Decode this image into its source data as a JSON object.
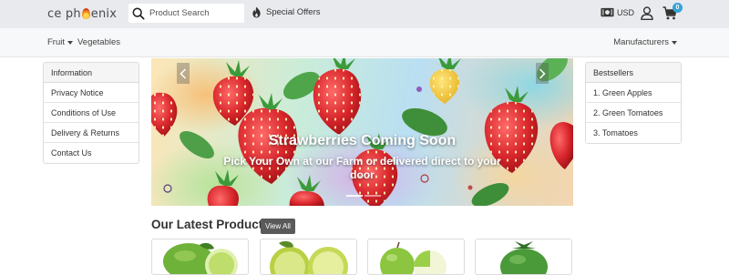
{
  "header": {
    "logo_text": "ce phoenix",
    "search": {
      "placeholder": "Product Search"
    },
    "special_offers_label": "Special Offers",
    "currency_label": "USD",
    "cart_count": "0",
    "icons": {
      "search": "search-icon",
      "special": "flame-icon",
      "currency": "money-icon",
      "user": "user-icon",
      "cart": "cart-icon"
    }
  },
  "nav": {
    "items": [
      {
        "label": "Fruit",
        "dropdown": true
      },
      {
        "label": "Vegetables",
        "dropdown": false
      }
    ],
    "manufacturers_label": "Manufacturers"
  },
  "information_box": {
    "title": "Information",
    "links": [
      "Privacy Notice",
      "Conditions of Use",
      "Delivery & Returns",
      "Contact Us"
    ]
  },
  "bestsellers_box": {
    "title": "Bestsellers",
    "items": [
      "1. Green Apples",
      "2. Green Tomatoes",
      "3. Tomatoes"
    ]
  },
  "carousel": {
    "title": "Strawberries Coming Soon",
    "subtitle": "Pick Your Own at our Farm or delivered direct to your door",
    "slide_count": 2,
    "active_slide": 1
  },
  "latest_products": {
    "title": "Our Latest Products",
    "view_all_label": "View All"
  },
  "colors": {
    "topbar_bg": "#e9eaee",
    "navbar_bg": "#f7f8f9",
    "badge": "#36a3d9",
    "view_all_bg": "#5a5a5a"
  }
}
